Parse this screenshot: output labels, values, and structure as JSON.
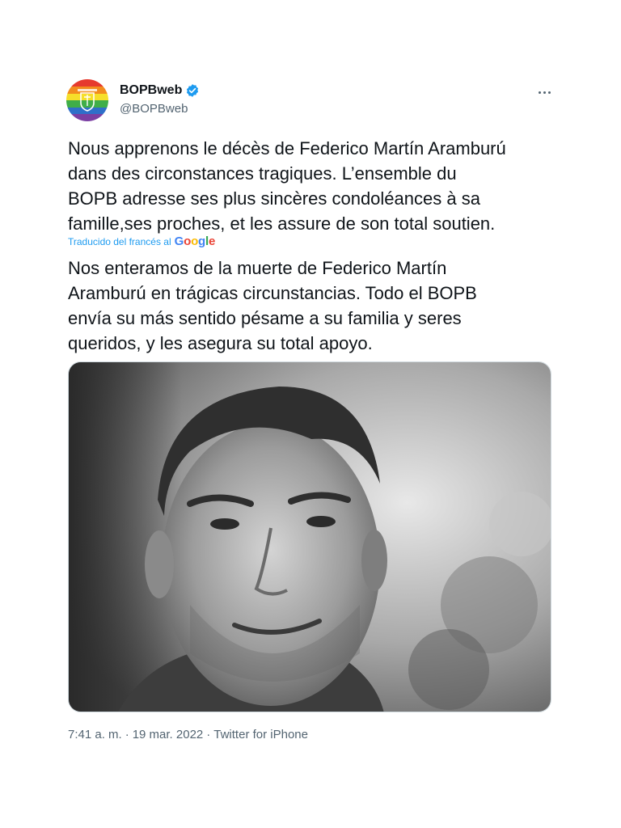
{
  "author": {
    "display_name": "BOPBweb",
    "handle": "@BOPBweb",
    "avatar_icon": "rainbow-club-crest-icon",
    "verified_icon": "verified-badge-icon"
  },
  "tweet": {
    "original_text": "Nous apprenons le décès de Federico Martín Aramburú\ndans des circonstances tragiques. L’ensemble du\nBOPB adresse ses plus sincères condoléances à sa\nfamille,ses proches, et les assure de son total soutien.",
    "translation_label": "Traducido del francés al",
    "translation_provider": "Google",
    "translated_text": "Nos enteramos de la muerte de Federico Martín\nAramburú en trágicas circunstancias. Todo el BOPB\nenvía su más sentido pésame a su familia y seres\nqueridos, y les asegura su total apoyo.",
    "media_icon": "portrait-photo-icon"
  },
  "footer": {
    "time": "7:41 a. m.",
    "separator": "·",
    "date": "19 mar. 2022",
    "source": "Twitter for iPhone"
  },
  "colors": {
    "link": "#1d9bf0",
    "verified": "#1d9bf0",
    "secondary_text": "#536471",
    "primary_text": "#0f1419"
  }
}
